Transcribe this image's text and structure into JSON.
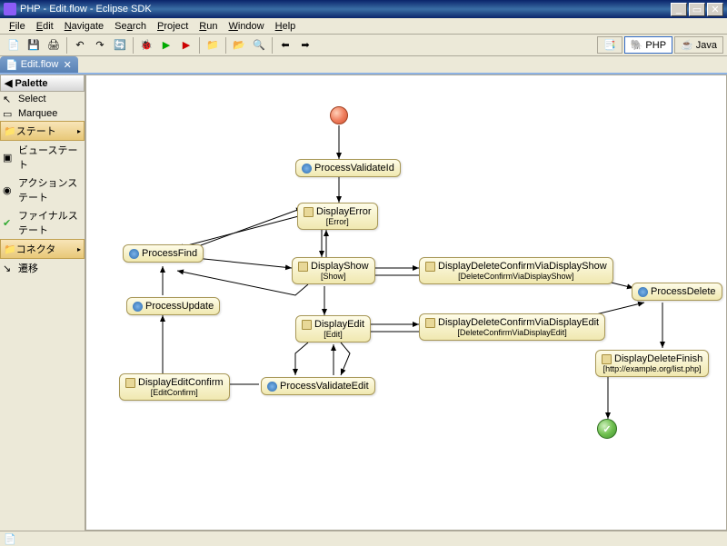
{
  "window": {
    "title": "PHP - Edit.flow - Eclipse SDK"
  },
  "menu": {
    "file": "File",
    "edit": "Edit",
    "navigate": "Navigate",
    "search": "Search",
    "project": "Project",
    "run": "Run",
    "window": "Window",
    "help": "Help"
  },
  "perspective": {
    "php": "PHP",
    "java": "Java"
  },
  "tab": {
    "name": "Edit.flow"
  },
  "palette": {
    "title": "Palette",
    "select": "Select",
    "marquee": "Marquee",
    "group_state": "ステート",
    "view_state": "ビューステート",
    "action_state": "アクションステート",
    "final_state": "ファイナルステート",
    "group_connector": "コネクタ",
    "transition": "遷移"
  },
  "nodes": {
    "processValidateId": {
      "title": "ProcessValidateId"
    },
    "displayError": {
      "title": "DisplayError",
      "sub": "[Error]"
    },
    "processFind": {
      "title": "ProcessFind"
    },
    "displayShow": {
      "title": "DisplayShow",
      "sub": "[Show]"
    },
    "displayDeleteConfirmShow": {
      "title": "DisplayDeleteConfirmViaDisplayShow",
      "sub": "[DeleteConfirmViaDisplayShow]"
    },
    "processDelete": {
      "title": "ProcessDelete"
    },
    "processUpdate": {
      "title": "ProcessUpdate"
    },
    "displayEdit": {
      "title": "DisplayEdit",
      "sub": "[Edit]"
    },
    "displayDeleteConfirmEdit": {
      "title": "DisplayDeleteConfirmViaDisplayEdit",
      "sub": "[DeleteConfirmViaDisplayEdit]"
    },
    "displayEditConfirm": {
      "title": "DisplayEditConfirm",
      "sub": "[EditConfirm]"
    },
    "processValidateEdit": {
      "title": "ProcessValidateEdit"
    },
    "displayDeleteFinish": {
      "title": "DisplayDeleteFinish",
      "sub": "[http://example.org/list.php]"
    }
  }
}
